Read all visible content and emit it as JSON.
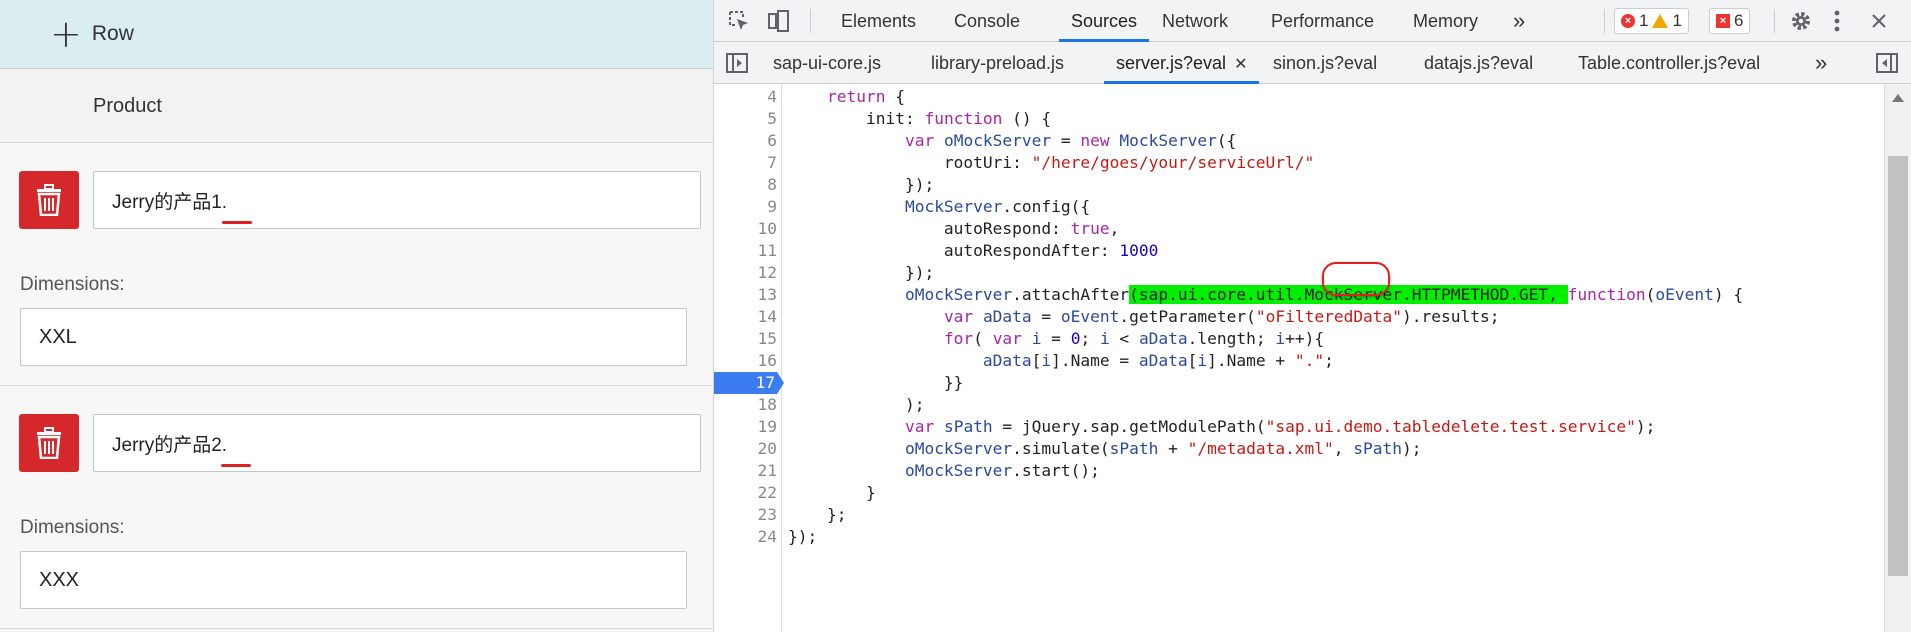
{
  "app": {
    "add_row_label": "Row",
    "product_header": "Product",
    "items": [
      {
        "name": "Jerry的产品1.",
        "dimensions_label": "Dimensions:",
        "dimensions_value": "XXL"
      },
      {
        "name": "Jerry的产品2.",
        "dimensions_label": "Dimensions:",
        "dimensions_value": "XXX"
      }
    ]
  },
  "devtools": {
    "tabs": [
      "Elements",
      "Console",
      "Sources",
      "Network",
      "Performance",
      "Memory"
    ],
    "active_tab": "Sources",
    "more_tabs": "»",
    "badges": {
      "errors": "1",
      "warnings": "1",
      "issues": "6"
    },
    "file_tabs": [
      "sap-ui-core.js",
      "library-preload.js",
      "server.js?eval",
      "sinon.js?eval",
      "datajs.js?eval",
      "Table.controller.js?eval"
    ],
    "active_file_tab": "server.js?eval",
    "close_glyph": "✕",
    "more_file_tabs": "»"
  },
  "editor": {
    "breakpoint_line": 17,
    "lines": [
      {
        "n": "4",
        "text": "    return {"
      },
      {
        "n": "5",
        "text": "        init: function () {"
      },
      {
        "n": "6",
        "text": "            var oMockServer = new MockServer({"
      },
      {
        "n": "7",
        "text": "                rootUri: \"/here/goes/your/serviceUrl/\""
      },
      {
        "n": "8",
        "text": "            });"
      },
      {
        "n": "9",
        "text": "            MockServer.config({"
      },
      {
        "n": "10",
        "text": "                autoRespond: true,"
      },
      {
        "n": "11",
        "text": "                autoRespondAfter: 1000"
      },
      {
        "n": "12",
        "text": "            });"
      },
      {
        "n": "13",
        "text": "            oMockServer.attachAfter(sap.ui.core.util.MockServer.HTTPMETHOD.GET, function(oEvent) {"
      },
      {
        "n": "14",
        "text": "                var aData = oEvent.getParameter(\"oFilteredData\").results;"
      },
      {
        "n": "15",
        "text": "                for( var i = 0; i < aData.length; i++){"
      },
      {
        "n": "16",
        "text": "                    aData[i].Name = aData[i].Name + \".\";"
      },
      {
        "n": "17",
        "text": "                }}"
      },
      {
        "n": "18",
        "text": "            );"
      },
      {
        "n": "19",
        "text": "            var sPath = jQuery.sap.getModulePath(\"sap.ui.demo.tabledelete.test.service\");"
      },
      {
        "n": "20",
        "text": "            oMockServer.simulate(sPath + \"/metadata.xml\", sPath);"
      },
      {
        "n": "21",
        "text": "            oMockServer.start();"
      },
      {
        "n": "22",
        "text": "        }"
      },
      {
        "n": "23",
        "text": "    };"
      },
      {
        "n": "24",
        "text": "});"
      }
    ]
  },
  "colors": {
    "delete_button": "#d5282b",
    "devtools_accent": "#1a73e8",
    "highlight": "#00f000",
    "annotation_red": "#e02020"
  }
}
